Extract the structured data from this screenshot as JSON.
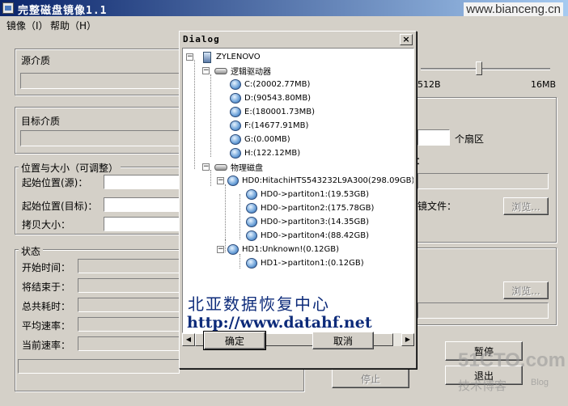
{
  "window": {
    "title": "完整磁盘镜像1.1",
    "watermark": "www.bianceng.cn"
  },
  "menu": {
    "items": [
      "镜像（I）",
      "帮助（H）"
    ]
  },
  "groups": {
    "source": "源介质",
    "target": "目标介质",
    "position": "位置与大小（可调整）",
    "status": "状态"
  },
  "position_fields": {
    "start_src": "起始位置(源)：",
    "start_dst": "起始位置(目标)：",
    "copy_size": "拷贝大小："
  },
  "status_fields": {
    "start_time": "开始时间：",
    "end_time": "将结束于：",
    "elapsed": "总共耗时：",
    "avg_rate": "平均速率：",
    "cur_rate": "当前速率："
  },
  "slider": {
    "min_label": "512B",
    "max_label": "16MB"
  },
  "right_panel": {
    "sector_label": "个扇区",
    "file_label": "镜文件：",
    "browse_1": "浏览...",
    "browse_2": "浏览..."
  },
  "buttons": {
    "stop": "停止",
    "pause": "暂停",
    "exit": "退出"
  },
  "dialog": {
    "title": "Dialog",
    "close": "×",
    "ok": "确定",
    "cancel": "取消",
    "tree": {
      "root": "ZYLENOVO",
      "logical": "逻辑驱动器",
      "drives": [
        "C:(20002.77MB)",
        "D:(90543.80MB)",
        "E:(180001.73MB)",
        "F:(14677.91MB)",
        "G:(0.00MB)",
        "H:(122.12MB)"
      ],
      "physical": "物理磁盘",
      "hd0": "HD0:HitachiHTS543232L9A300(298.09GB)",
      "hd0_parts": [
        "HD0->partiton1:(19.53GB)",
        "HD0->partiton2:(175.78GB)",
        "HD0->partiton3:(14.35GB)",
        "HD0->partiton4:(88.42GB)"
      ],
      "hd1": "HD1:Unknown!(0.12GB)",
      "hd1_parts": [
        "HD1->partiton1:(0.12GB)"
      ]
    }
  },
  "overlay": {
    "company": "北亚数据恢复中心",
    "url": "http://www.datahf.net"
  },
  "watermark_51": {
    "logo": "51CTO.com",
    "blog": "技术博客",
    "blog_en": "Blog"
  }
}
